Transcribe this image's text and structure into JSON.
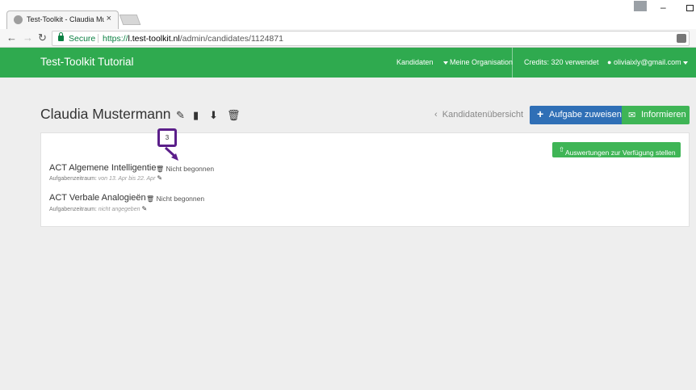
{
  "browser": {
    "tab_title": "Test-Toolkit - Claudia Mu",
    "tab_close": "×",
    "secure_label": "Secure",
    "url_prefix": "https://",
    "url_host": "l.test-toolkit.nl",
    "url_path": "/admin/candidates/1124871"
  },
  "navbar": {
    "brand": "Test-Toolkit Tutorial",
    "kandidaten": "Kandidaten",
    "organisation": "Meine Organisation",
    "credits": "Credits: 320 verwendet",
    "user": "oliviaixly@gmail.com"
  },
  "header": {
    "candidate_name": "Claudia Mustermann",
    "back_link": "Kandidatenübersicht",
    "assign_button": "Aufgabe zuweisen",
    "inform_button": "Informieren"
  },
  "panel": {
    "release_button": "Auswertungen zur Verfügung stellen",
    "tasks": [
      {
        "title": "ACT Algemene Intelligentie",
        "status": "Nicht begonnen",
        "period_label": "Aufgabenzeitraum:",
        "period_value": "von 13. Apr bis 22. Apr"
      },
      {
        "title": "ACT Verbale Analogieën",
        "status": "Nicht begonnen",
        "period_label": "Aufgabenzeitraum:",
        "period_value": "nicht angegeben"
      }
    ]
  },
  "annotation": {
    "marker_number": "3"
  },
  "colors": {
    "navbar": "#2faa4f",
    "primary_button": "#2f6fb6",
    "success_button": "#3fb556",
    "annotation": "#5b1f8a"
  }
}
